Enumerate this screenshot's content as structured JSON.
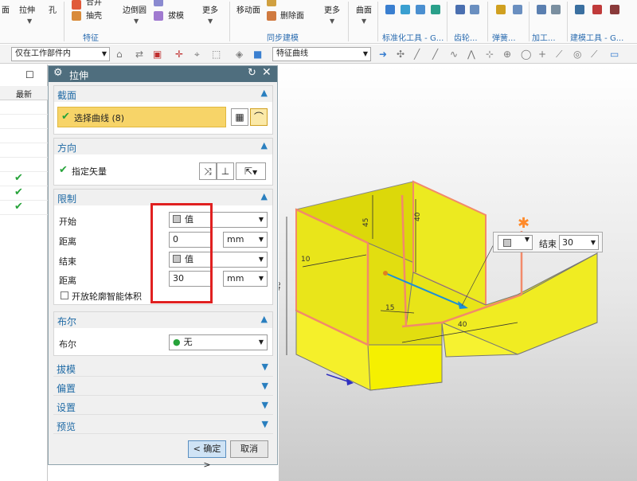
{
  "ribbon": {
    "items": [
      {
        "label": "面"
      },
      {
        "label": "拉伸"
      },
      {
        "label": "孔"
      },
      {
        "label": "合并"
      },
      {
        "label": "抽壳"
      },
      {
        "label": "边倒圆"
      },
      {
        "label": "拔模"
      },
      {
        "label": "更多"
      },
      {
        "label": "移动面"
      },
      {
        "label": "删除面"
      },
      {
        "label": "更多"
      },
      {
        "label": "曲面"
      }
    ],
    "groups": {
      "feature": "特征",
      "sync": "同步建模",
      "standard": "标准化工具 - G...",
      "gear": "齿轮...",
      "spring": "弹簧...",
      "machining": "加工...",
      "modeling_tools": "建模工具 - G..."
    }
  },
  "toolbar": {
    "filter_select": "仅在工作部件内",
    "curve_rule": "特征曲线"
  },
  "navigator": {
    "column_header": "最新"
  },
  "dialog": {
    "title": "拉伸",
    "section": {
      "title": "截面",
      "select_curve": "选择曲线 (8)"
    },
    "direction": {
      "title": "方向",
      "vector_label": "指定矢量"
    },
    "limits": {
      "title": "限制",
      "start_label": "开始",
      "start_type": "值",
      "distance_label": "距离",
      "start_distance": "0",
      "unit": "mm",
      "end_label": "结束",
      "end_type": "值",
      "end_distance": "30",
      "open_profile": "开放轮廓智能体积"
    },
    "boolean": {
      "title": "布尔",
      "label": "布尔",
      "value": "无"
    },
    "collapsed": {
      "draft": "拔模",
      "offset": "偏置",
      "settings": "设置",
      "preview": "预览"
    },
    "ok": "< 确定 >",
    "cancel": "取消"
  },
  "viewport": {
    "dims": {
      "d45": "45",
      "d40": "40",
      "d10": "10",
      "d15": "15",
      "d40b": "40",
      "d40c": "40"
    },
    "handle": {
      "label": "结束",
      "value": "30"
    }
  },
  "colors": {
    "dialog_title": "#4f6e7e",
    "section_text": "#1f6aa5",
    "check": "#27a33a",
    "highlight": "#f7d468",
    "redbox": "#e02020",
    "body_yellow": "#f0ef1a"
  }
}
